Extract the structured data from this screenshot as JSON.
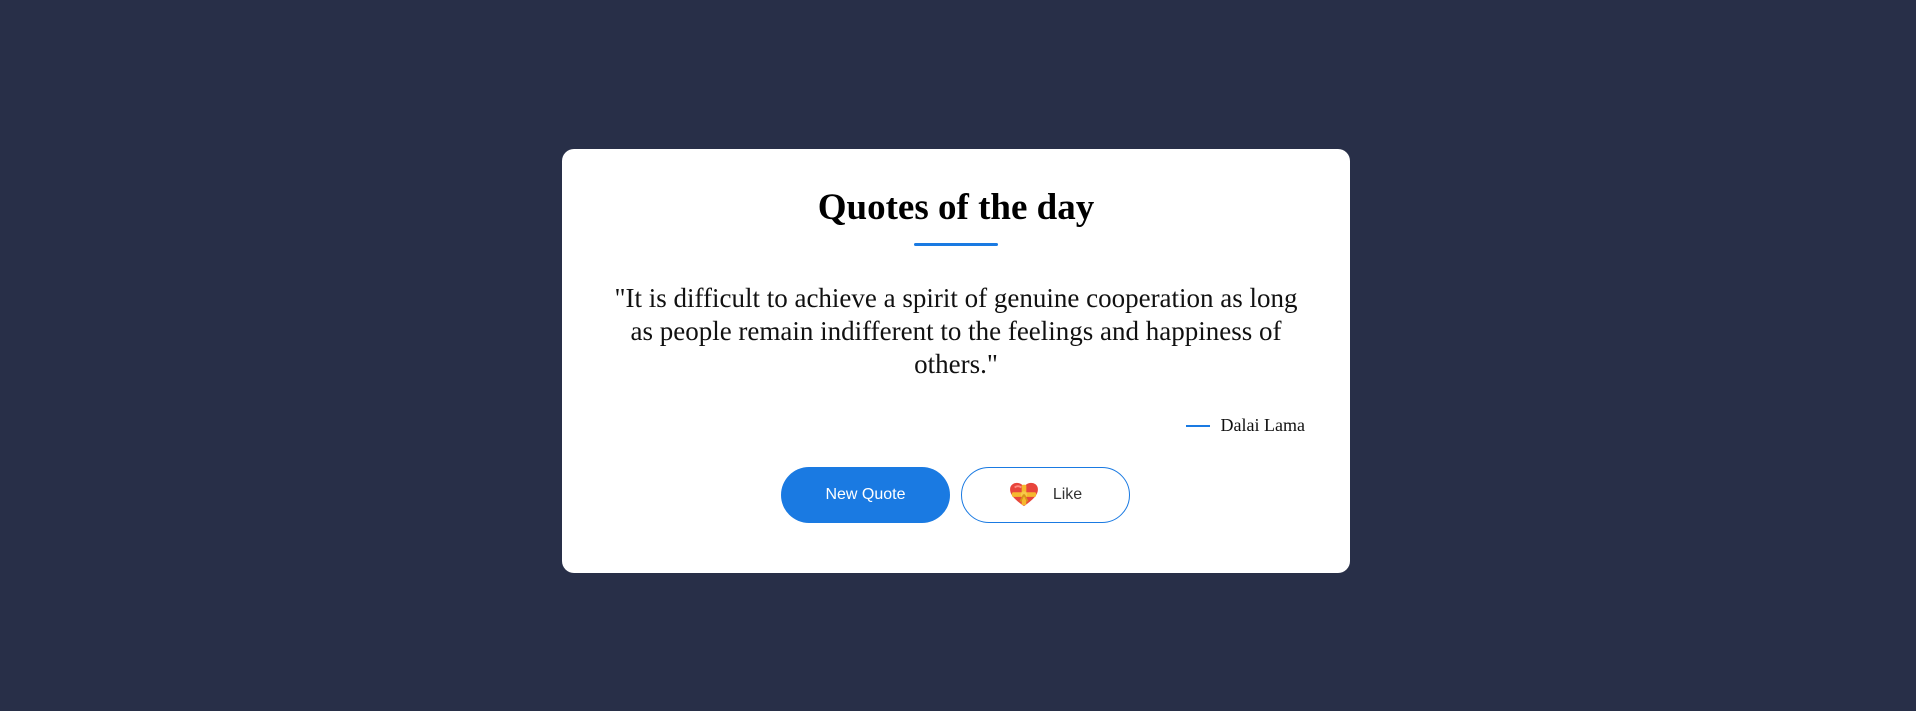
{
  "card": {
    "title": "Quotes of the day",
    "quote": "\"It is difficult to achieve a spirit of genuine cooperation as long as people remain indifferent to the feelings and happiness of others.\"",
    "author": "Dalai Lama"
  },
  "buttons": {
    "new_quote_label": "New Quote",
    "like_label": "Like",
    "like_icon": "heart-with-ribbon-icon"
  },
  "colors": {
    "background": "#282f48",
    "card": "#ffffff",
    "accent": "#1a7ae2"
  }
}
